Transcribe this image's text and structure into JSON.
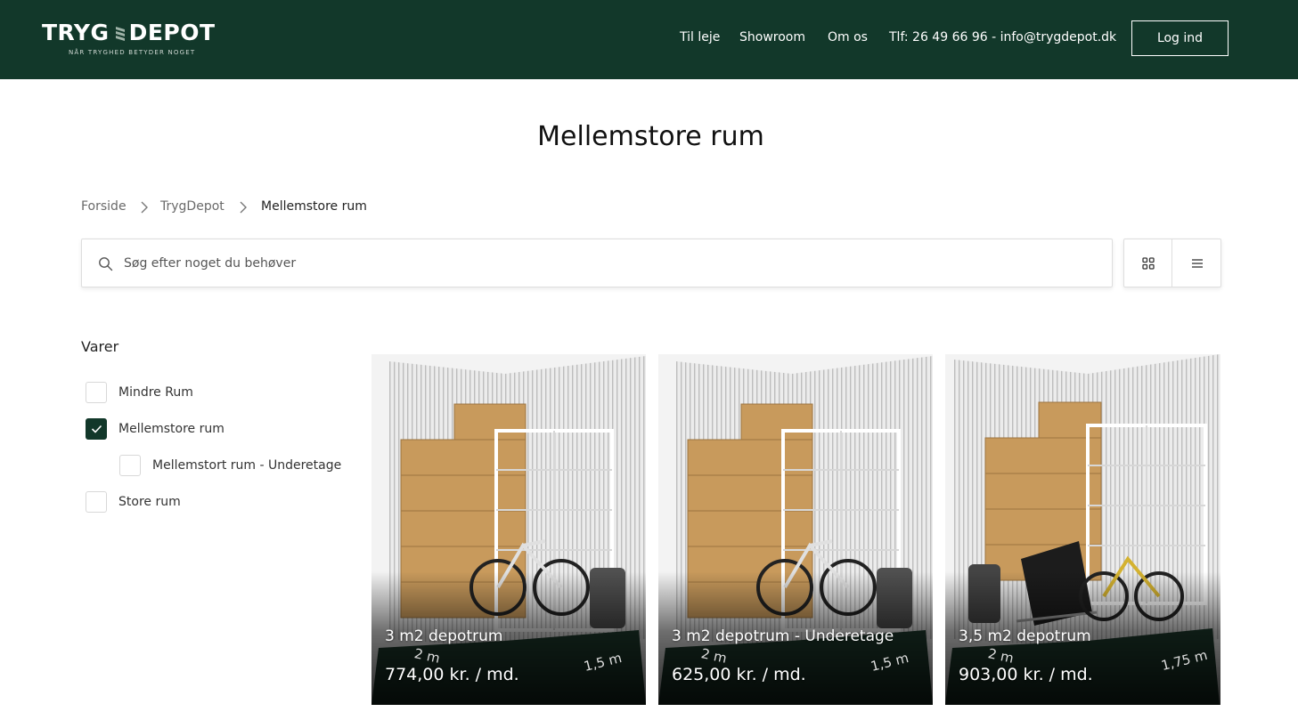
{
  "header": {
    "logo_word1": "TRYG",
    "logo_word2": "DEPOT",
    "logo_tagline": "NÅR TRYGHED BETYDER NOGET",
    "nav": {
      "til_leje": "Til leje",
      "showroom": "Showroom",
      "om_os": "Om os",
      "contact": "Tlf: 26 49 66 96 - info@trygdepot.dk"
    },
    "login_label": "Log ind"
  },
  "page_title": "Mellemstore rum",
  "breadcrumb": {
    "items": [
      "Forside",
      "TrygDepot",
      "Mellemstore rum"
    ]
  },
  "search": {
    "placeholder": "Søg efter noget du behøver",
    "value": ""
  },
  "filters": {
    "title": "Varer",
    "items": [
      {
        "label": "Mindre Rum",
        "checked": false
      },
      {
        "label": "Mellemstore rum",
        "checked": true
      },
      {
        "label": "Mellemstort rum - Underetage",
        "checked": false
      },
      {
        "label": "Store rum",
        "checked": false
      }
    ]
  },
  "products": [
    {
      "name": "3 m2 depotrum",
      "price": "774,00 kr. / md.",
      "dim_a": "2 m",
      "dim_b": "1,5 m"
    },
    {
      "name": "3 m2 depotrum - Underetage",
      "price": "625,00 kr. / md.",
      "dim_a": "2 m",
      "dim_b": "1,5 m"
    },
    {
      "name": "3,5 m2 depotrum",
      "price": "903,00 kr. / md.",
      "dim_a": "2 m",
      "dim_b": "1,75 m"
    }
  ],
  "colors": {
    "brand_green": "#12382a",
    "box_cardboard": "#c89a5c"
  },
  "icons": {
    "search": "search-icon",
    "grid_view": "grid-view-icon",
    "list_view": "list-view-icon",
    "check": "check-icon"
  }
}
